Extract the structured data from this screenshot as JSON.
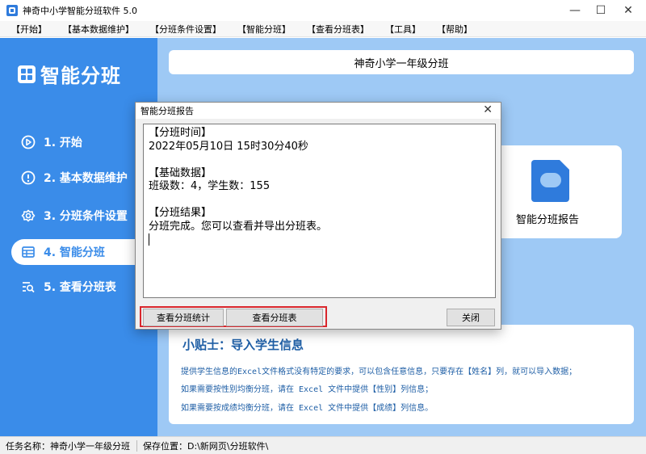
{
  "window": {
    "title": "神奇中小学智能分班软件 5.0",
    "minimize": "—",
    "maximize": "☐",
    "close": "✕"
  },
  "menu": [
    "【开始】",
    "【基本数据维护】",
    "【分班条件设置】",
    "【智能分班】",
    "【查看分班表】",
    "【工具】",
    "【帮助】"
  ],
  "sidebar": {
    "logo_text": "智能分班",
    "items": [
      {
        "label": "1. 开始",
        "icon": "play-icon",
        "active": false
      },
      {
        "label": "2. 基本数据维护",
        "icon": "info-icon",
        "active": false
      },
      {
        "label": "3. 分班条件设置",
        "icon": "gear-icon",
        "active": false
      },
      {
        "label": "4. 智能分班",
        "icon": "table-icon",
        "active": true
      },
      {
        "label": "5. 查看分班表",
        "icon": "search-list-icon",
        "active": false
      }
    ]
  },
  "main": {
    "banner": "神奇小学一年级分班",
    "report_card_label": "智能分班报告",
    "tips": {
      "title": "小贴士：导入学生信息",
      "lines": [
        "提供学生信息的Excel文件格式没有特定的要求，可以包含任意信息，只要存在【姓名】列，就可以导入数据；",
        "如果需要按性别均衡分班，请在 Excel 文件中提供【性别】列信息；",
        "如果需要按成绩均衡分班，请在 Excel 文件中提供【成绩】列信息。"
      ]
    }
  },
  "statusbar": {
    "task": "任务名称：神奇小学一年级分班",
    "save": "保存位置：D:\\新网页\\分班软件\\"
  },
  "dialog": {
    "title": "智能分班报告",
    "close": "✕",
    "lines": [
      "【分班时间】",
      "2022年05月10日 15时30分40秒",
      "",
      "【基础数据】",
      "班级数：4，学生数：155",
      "",
      "【分班结果】",
      "分班完成。您可以查看并导出分班表。"
    ],
    "buttons": {
      "stats": "查看分班统计",
      "table": "查看分班表",
      "close": "关闭"
    }
  },
  "colors": {
    "sidebar": "#3a8ce9",
    "content_bg": "#9ec9f5",
    "tip_text": "#1f5fa6",
    "highlight": "#d9262c"
  }
}
